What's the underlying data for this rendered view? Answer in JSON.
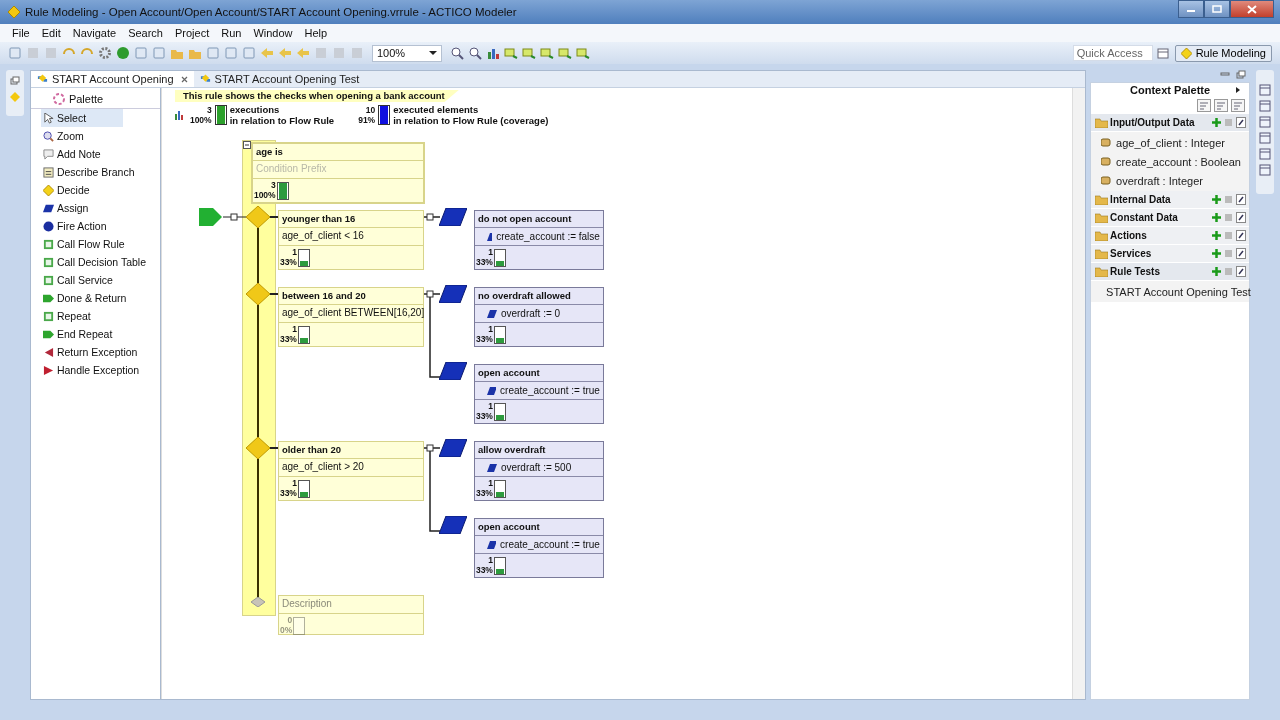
{
  "window": {
    "title": "Rule Modeling - Open Account/Open Account/START Account Opening.vrrule - ACTICO Modeler"
  },
  "menu": [
    "File",
    "Edit",
    "Navigate",
    "Search",
    "Project",
    "Run",
    "Window",
    "Help"
  ],
  "toolbar": {
    "zoom": "100%",
    "quick_access": {
      "placeholder": "Quick Access"
    },
    "perspective": "Rule Modeling"
  },
  "editor_tabs": [
    {
      "label": "START Account Opening",
      "selected": true
    },
    {
      "label": "START Account Opening Test",
      "selected": false
    }
  ],
  "palette": {
    "title": "Palette",
    "items": [
      {
        "label": "Select",
        "kind": "select",
        "selected": true
      },
      {
        "label": "Zoom",
        "kind": "zoom",
        "selected": false
      },
      {
        "label": "Add Note",
        "kind": "note",
        "selected": false
      },
      {
        "label": "Describe Branch",
        "kind": "describe",
        "selected": false
      },
      {
        "label": "Decide",
        "kind": "decide",
        "selected": false
      },
      {
        "label": "Assign",
        "kind": "assign",
        "selected": false
      },
      {
        "label": "Fire Action",
        "kind": "action",
        "selected": false
      },
      {
        "label": "Call Flow Rule",
        "kind": "call",
        "selected": false
      },
      {
        "label": "Call Decision Table",
        "kind": "call",
        "selected": false
      },
      {
        "label": "Call Service",
        "kind": "call",
        "selected": false
      },
      {
        "label": "Done & Return",
        "kind": "done",
        "selected": false
      },
      {
        "label": "Repeat",
        "kind": "call",
        "selected": false
      },
      {
        "label": "End Repeat",
        "kind": "done",
        "selected": false
      },
      {
        "label": "Return Exception",
        "kind": "return",
        "selected": false
      },
      {
        "label": "Handle Exception",
        "kind": "handle",
        "selected": false
      }
    ]
  },
  "diagram": {
    "note": "This rule shows the checks when opening a bank account",
    "stats": [
      {
        "count": "3",
        "percent": "100%",
        "level": 1,
        "color": "#2ca02c",
        "label": "executions",
        "sublabel": "in relation to Flow Rule"
      },
      {
        "count": "10",
        "percent": "91%",
        "level": 1,
        "color": "#1010e0",
        "label": "executed elements",
        "sublabel": "in relation to Flow Rule (coverage)"
      }
    ],
    "condition": {
      "title": "age is",
      "placeholder": "Condition Prefix",
      "count": "3",
      "percent": "100%",
      "level": 1
    },
    "branches": [
      {
        "title": "younger than 16",
        "expression": "age_of_client < 16",
        "count": "1",
        "percent": "33%",
        "level": 0.33,
        "actions": [
          {
            "title": "do not open account",
            "assignment": "create_account := false",
            "count": "1",
            "percent": "33%",
            "level": 0.33
          }
        ]
      },
      {
        "title": "between 16 and 20",
        "expression": "age_of_client BETWEEN[16,20]",
        "count": "1",
        "percent": "33%",
        "level": 0.33,
        "actions": [
          {
            "title": "no overdraft allowed",
            "assignment": "overdraft := 0",
            "count": "1",
            "percent": "33%",
            "level": 0.33
          },
          {
            "title": "open account",
            "assignment": "create_account := true",
            "count": "1",
            "percent": "33%",
            "level": 0.33
          }
        ]
      },
      {
        "title": "older than 20",
        "expression": "age_of_client > 20",
        "count": "1",
        "percent": "33%",
        "level": 0.33,
        "actions": [
          {
            "title": "allow overdraft",
            "assignment": "overdraft := 500",
            "count": "1",
            "percent": "33%",
            "level": 0.33
          },
          {
            "title": "open account",
            "assignment": "create_account := true",
            "count": "1",
            "percent": "33%",
            "level": 0.33
          }
        ]
      }
    ],
    "description": {
      "placeholder": "Description",
      "count": "0",
      "percent": "0%",
      "level": 0
    }
  },
  "context_palette": {
    "title": "Context Palette",
    "sections": [
      {
        "label": "Input/Output Data",
        "expanded": true,
        "items": [
          "age_of_client : Integer",
          "create_account : Boolean",
          "overdraft : Integer"
        ]
      },
      {
        "label": "Internal Data",
        "expanded": false
      },
      {
        "label": "Constant Data",
        "expanded": false
      },
      {
        "label": "Actions",
        "expanded": false
      },
      {
        "label": "Services",
        "expanded": false
      },
      {
        "label": "Rule Tests",
        "expanded": true,
        "items": [
          "START Account Opening Test"
        ]
      }
    ]
  }
}
